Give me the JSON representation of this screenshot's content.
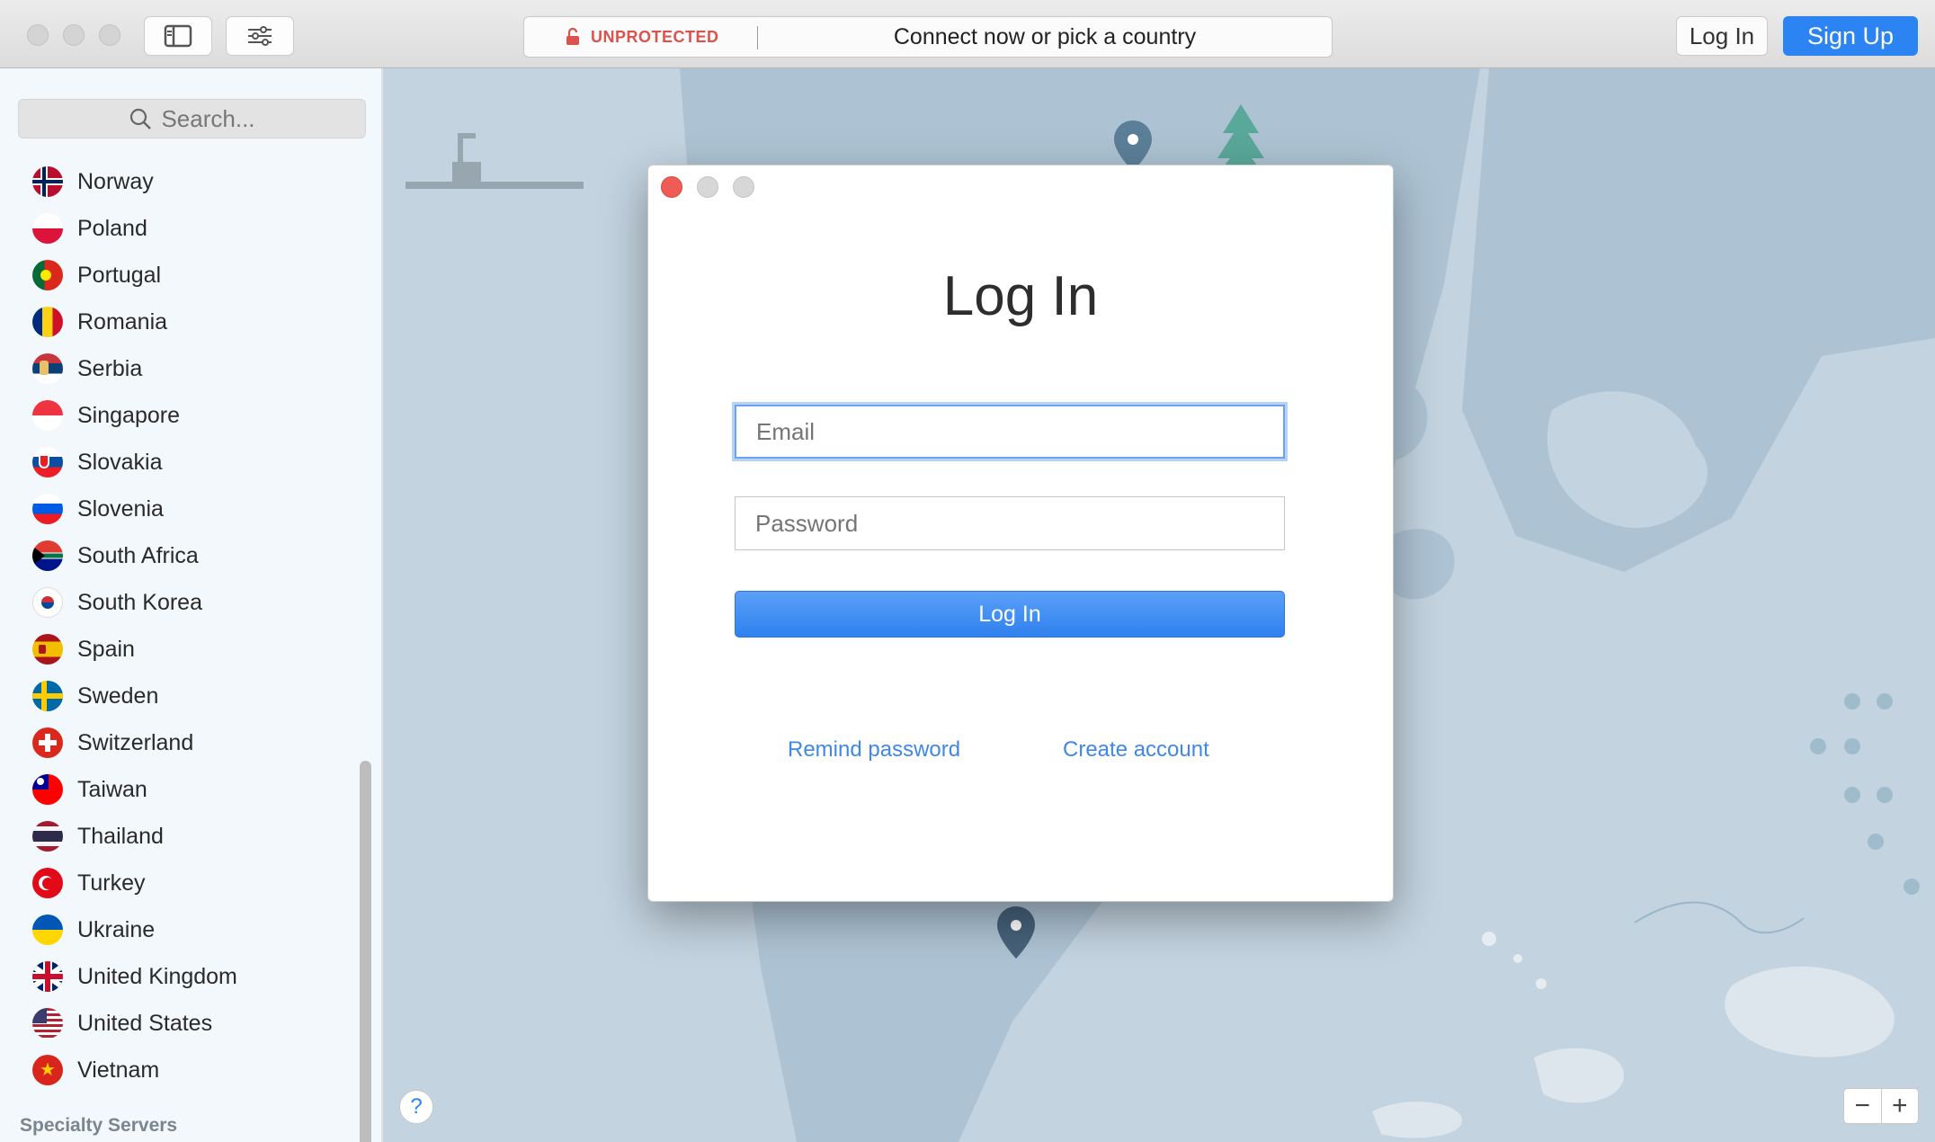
{
  "titlebar": {
    "status": "UNPROTECTED",
    "prompt": "Connect now or pick a country",
    "login_label": "Log In",
    "signup_label": "Sign Up"
  },
  "sidebar": {
    "search_placeholder": "Search...",
    "countries": [
      "Norway",
      "Poland",
      "Portugal",
      "Romania",
      "Serbia",
      "Singapore",
      "Slovakia",
      "Slovenia",
      "South Africa",
      "South Korea",
      "Spain",
      "Sweden",
      "Switzerland",
      "Taiwan",
      "Thailand",
      "Turkey",
      "Ukraine",
      "United Kingdom",
      "United States",
      "Vietnam"
    ],
    "section_footer": "Specialty Servers"
  },
  "map": {
    "help_label": "?",
    "zoom_out": "−",
    "zoom_in": "+"
  },
  "login_dialog": {
    "title": "Log In",
    "email_placeholder": "Email",
    "password_placeholder": "Password",
    "submit_label": "Log In",
    "remind_password": "Remind password",
    "create_account": "Create account"
  },
  "colors": {
    "accent": "#2c84f2",
    "unprotected": "#d9534f",
    "map_land": "#c3d3df",
    "map_water": "#adc3d3"
  }
}
